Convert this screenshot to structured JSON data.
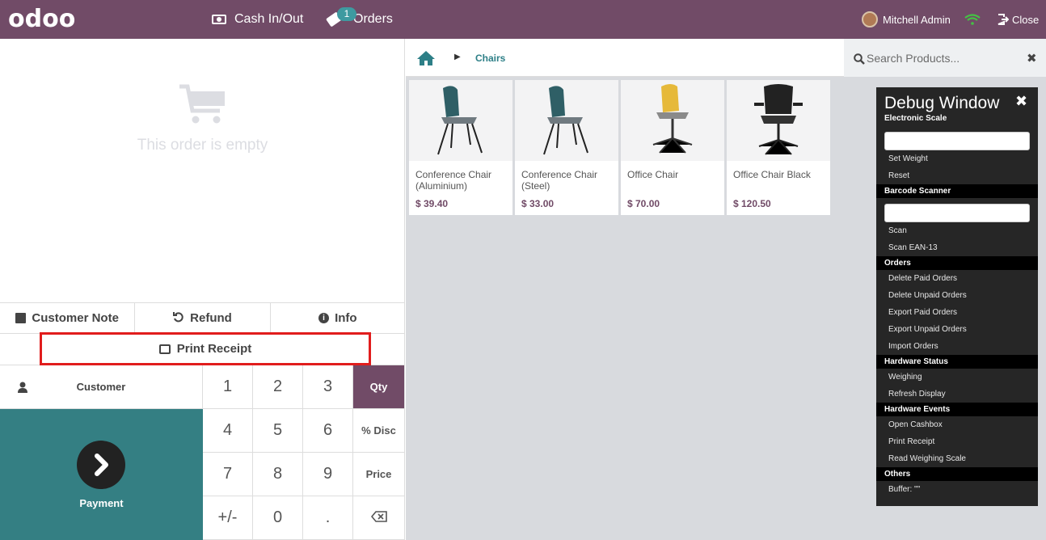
{
  "topbar": {
    "logo": "odoo",
    "cash_label": "Cash In/Out",
    "orders_label": "Orders",
    "orders_badge": "1",
    "user_name": "Mitchell Admin",
    "close_label": "Close",
    "brand_color": "#714B67"
  },
  "order": {
    "empty_text": "This order is empty"
  },
  "controls": {
    "customer_note": "Customer Note",
    "refund": "Refund",
    "info": "Info",
    "print_receipt": "Print Receipt"
  },
  "pad": {
    "customer": "Customer",
    "payment": "Payment",
    "keys": [
      "1",
      "2",
      "3",
      "4",
      "5",
      "6",
      "7",
      "8",
      "9",
      "+/-",
      "0",
      "."
    ],
    "modes": [
      "Qty",
      "% Disc",
      "Price"
    ],
    "active_mode": "Qty",
    "payment_color": "#347f83"
  },
  "breadcrumb": {
    "category": "Chairs"
  },
  "search": {
    "placeholder": "Search Products..."
  },
  "products": [
    {
      "name": "Conference Chair (Aluminium)",
      "price": "$ 39.40"
    },
    {
      "name": "Conference Chair (Steel)",
      "price": "$ 33.00"
    },
    {
      "name": "Office Chair",
      "price": "$ 70.00"
    },
    {
      "name": "Office Chair Black",
      "price": "$ 120.50"
    }
  ],
  "debug": {
    "title": "Debug Window",
    "electronic_scale": "Electronic Scale",
    "set_weight": "Set Weight",
    "reset": "Reset",
    "barcode_scanner": "Barcode Scanner",
    "scan": "Scan",
    "scan_ean13": "Scan EAN-13",
    "orders": "Orders",
    "delete_paid": "Delete Paid Orders",
    "delete_unpaid": "Delete Unpaid Orders",
    "export_paid": "Export Paid Orders",
    "export_unpaid": "Export Unpaid Orders",
    "import_orders": "Import Orders",
    "hardware_status": "Hardware Status",
    "weighing": "Weighing",
    "refresh_display": "Refresh Display",
    "hardware_events": "Hardware Events",
    "open_cashbox": "Open Cashbox",
    "print_receipt": "Print Receipt",
    "read_weighing_scale": "Read Weighing Scale",
    "others": "Others",
    "buffer": "Buffer: \"\""
  }
}
